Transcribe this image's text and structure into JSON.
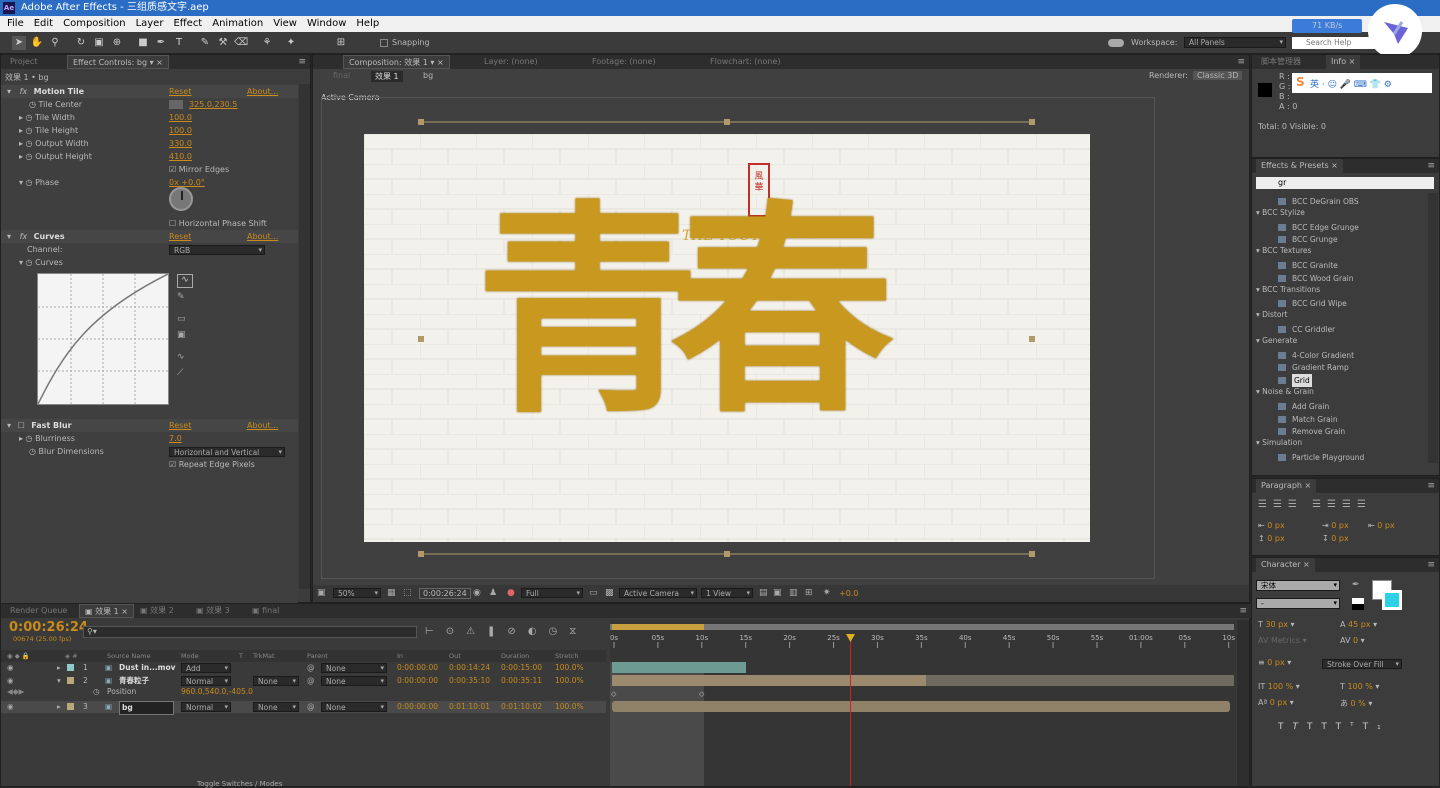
{
  "app": {
    "title": "Adobe After Effects - 三组质感文字.aep",
    "logo": "Ae"
  },
  "menu": [
    "File",
    "Edit",
    "Composition",
    "Layer",
    "Effect",
    "Animation",
    "View",
    "Window",
    "Help"
  ],
  "toolbar": {
    "snapping": "Snapping",
    "workspace_label": "Workspace:",
    "workspace_value": "All Panels",
    "search_placeholder": "Search Help",
    "net_speed": "71 KB/s"
  },
  "project_panel": {
    "tab_project": "Project",
    "tab_effects": "Effect Controls: bg",
    "breadcrumb": "效果 1 • bg"
  },
  "effects": {
    "motion_tile": {
      "name": "Motion Tile",
      "reset": "Reset",
      "about": "About...",
      "props": [
        {
          "label": "Tile Center",
          "value": "325.0,230.5"
        },
        {
          "label": "Tile Width",
          "value": "100.0"
        },
        {
          "label": "Tile Height",
          "value": "100.0"
        },
        {
          "label": "Output Width",
          "value": "330.0"
        },
        {
          "label": "Output Height",
          "value": "410.0"
        }
      ],
      "mirror_edges": "Mirror Edges",
      "phase_label": "Phase",
      "phase_value": "0x +0.0°",
      "horizontal_phase_shift": "Horizontal Phase Shift"
    },
    "curves": {
      "name": "Curves",
      "reset": "Reset",
      "about": "About...",
      "channel_label": "Channel:",
      "channel_value": "RGB",
      "curves_label": "Curves"
    },
    "fast_blur": {
      "name": "Fast Blur",
      "reset": "Reset",
      "about": "About...",
      "blurriness_label": "Blurriness",
      "blurriness_value": "7.0",
      "dimensions_label": "Blur Dimensions",
      "dimensions_value": "Horizontal and Vertical",
      "repeat_edge": "Repeat Edge Pixels"
    }
  },
  "composition": {
    "tab": "Composition: 效果 1",
    "layer_tab": "Layer: (none)",
    "footage_tab": "Footage: (none)",
    "flowchart_tab": "Flowchart: (none)",
    "nav_final": "final",
    "nav_current": "效果 1",
    "nav_bg": "bg",
    "renderer_label": "Renderer:",
    "renderer_value": "Classic 3D",
    "active_camera": "Active Camera",
    "artwork_text": "青春",
    "artwork_sub": "THE YOUTH",
    "stamp_text": "風華"
  },
  "viewer_footer": {
    "zoom": "50%",
    "timecode": "0:00:26:24",
    "resolution": "Full",
    "camera": "Active Camera",
    "view": "1 View",
    "exposure": "+0.0"
  },
  "info_panel": {
    "tab_script": "脚本管理器",
    "tab_info": "Info",
    "r": "R :",
    "g": "G :",
    "b": "B :",
    "a": "A : 0",
    "total": "Total: 0  Visible: 0"
  },
  "effects_presets": {
    "tab": "Effects & Presets",
    "search": "gr",
    "items": [
      {
        "type": "item",
        "label": "BCC DeGrain OBS"
      },
      {
        "type": "cat",
        "label": "BCC Stylize"
      },
      {
        "type": "item",
        "label": "BCC Edge Grunge"
      },
      {
        "type": "item",
        "label": "BCC Grunge"
      },
      {
        "type": "cat",
        "label": "BCC Textures"
      },
      {
        "type": "item",
        "label": "BCC Granite"
      },
      {
        "type": "item",
        "label": "BCC Wood Grain"
      },
      {
        "type": "cat",
        "label": "BCC Transitions"
      },
      {
        "type": "item",
        "label": "BCC Grid Wipe"
      },
      {
        "type": "cat",
        "label": "Distort"
      },
      {
        "type": "item",
        "label": "CC Griddler"
      },
      {
        "type": "cat",
        "label": "Generate"
      },
      {
        "type": "item",
        "label": "4-Color Gradient"
      },
      {
        "type": "item",
        "label": "Gradient Ramp"
      },
      {
        "type": "item",
        "label": "Grid",
        "selected": true
      },
      {
        "type": "cat",
        "label": "Noise & Grain"
      },
      {
        "type": "item",
        "label": "Add Grain"
      },
      {
        "type": "item",
        "label": "Match Grain"
      },
      {
        "type": "item",
        "label": "Remove Grain"
      },
      {
        "type": "cat",
        "label": "Simulation"
      },
      {
        "type": "item",
        "label": "Particle Playground"
      }
    ]
  },
  "paragraph": {
    "tab": "Paragraph",
    "v1": "0 px",
    "v2": "0 px",
    "v3": "0 px",
    "v4": "0 px",
    "v5": "0 px"
  },
  "character": {
    "tab": "Character",
    "font": "宋体",
    "style": "-",
    "size": "30 px",
    "leading": "45 px",
    "kerning": "Metrics",
    "tracking": "0",
    "stroke_width": "0 px",
    "stroke_type": "Stroke Over Fill",
    "vscale": "100 %",
    "hscale": "100 %",
    "baseline": "0 px",
    "tsume": "0 %"
  },
  "timeline": {
    "tabs": [
      "Render Queue",
      "效果 1",
      "效果 2",
      "效果 3",
      "final"
    ],
    "timecode": "0:00:26:24",
    "frames": "00674 (25.00 fps)",
    "headers": {
      "source": "Source Name",
      "mode": "Mode",
      "t": "T",
      "trkmat": "TrkMat",
      "parent": "Parent",
      "in": "In",
      "out": "Out",
      "duration": "Duration",
      "stretch": "Stretch"
    },
    "ruler": [
      "0s",
      "05s",
      "10s",
      "15s",
      "20s",
      "25s",
      "30s",
      "35s",
      "40s",
      "45s",
      "50s",
      "55s",
      "01:00s",
      "05s",
      "10s"
    ],
    "layers": [
      {
        "num": "1",
        "name": "Dust in...mov",
        "mode": "Add",
        "trkmat": "",
        "parent": "None",
        "in": "0:00:00:00",
        "out": "0:00:14:24",
        "duration": "0:00:15:00",
        "stretch": "100.0%"
      },
      {
        "num": "2",
        "name": "青春粒子",
        "mode": "Normal",
        "trkmat": "None",
        "parent": "None",
        "in": "0:00:00:00",
        "out": "0:00:35:10",
        "duration": "0:00:35:11",
        "stretch": "100.0%"
      },
      {
        "num": "3",
        "name": "bg",
        "mode": "Normal",
        "trkmat": "None",
        "parent": "None",
        "in": "0:00:00:00",
        "out": "0:01:10:01",
        "duration": "0:01:10:02",
        "stretch": "100.0%"
      }
    ],
    "position_label": "Position",
    "position_value": "960.0,540.0,-405.0",
    "toggle": "Toggle Switches / Modes"
  },
  "colors": {
    "accent": "#c98b1a",
    "gold": "#c99a1e",
    "titlebar": "#2b6cc4"
  }
}
